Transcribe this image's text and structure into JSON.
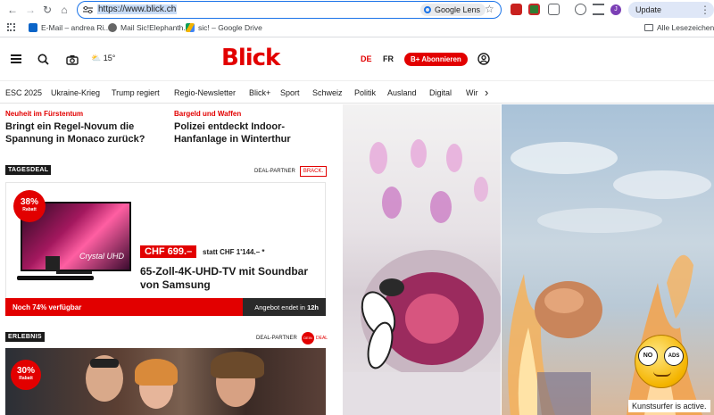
{
  "browser": {
    "url": "https://www.blick.ch",
    "lens_label": "Google Lens",
    "update_label": "Update abschließen",
    "avatar_letter": "J",
    "bookmarks": [
      {
        "label": "E-Mail – andrea Ri...",
        "color": "#0a64c8"
      },
      {
        "label": "Mail Sic!Elephanth...",
        "color": "#666666"
      },
      {
        "label": "sic! – Google Drive",
        "color": "#f4b400"
      }
    ],
    "all_bookmarks_label": "Alle Lesezeichen"
  },
  "header": {
    "logo": "Blick",
    "temperature": "15°",
    "lang_de": "DE",
    "lang_fr": "FR",
    "abo_label": "B+ Abonnieren"
  },
  "nav": {
    "items": [
      "ESC 2025",
      "Ukraine-Krieg",
      "Trump regiert",
      "Regio-Newsletter",
      "Blick+",
      "Sport",
      "Schweiz",
      "Politik",
      "Ausland",
      "Digital",
      "Wir"
    ]
  },
  "teasers": [
    {
      "kicker": "Neuheit im Fürstentum",
      "headline": "Bringt ein Regel-Novum die Spannung in Monaco zurück?"
    },
    {
      "kicker": "Bargeld und Waffen",
      "headline": "Polizei entdeckt Indoor-Hanfanlage in Winterthur"
    }
  ],
  "deal": {
    "section": "TAGESDEAL",
    "partner": "DEAL-PARTNER",
    "partner_logo": "BRACK.",
    "discount": "38%",
    "discount_label": "Rabatt",
    "tv_brand": "Crystal UHD",
    "price": "CHF 699.–",
    "price_old": "statt CHF 1'144.– *",
    "title": "65-Zoll-4K-UHD-TV mit Soundbar von Samsung",
    "availability": "Noch 74% verfügbar",
    "availability_fraction": 0.74,
    "ends_prefix": "Angebot endet in",
    "ends_value": "12h"
  },
  "erlebnis": {
    "section": "ERLEBNIS",
    "partner": "DEAL-PARTNER",
    "partner_logo_line1": "DEIN",
    "partner_logo_line2": "DEAL",
    "discount": "30%",
    "discount_label": "Rabatt"
  },
  "overlay": {
    "noads_left": "NO",
    "noads_right": "ADS",
    "badge": "Kunstsurfer is active."
  }
}
